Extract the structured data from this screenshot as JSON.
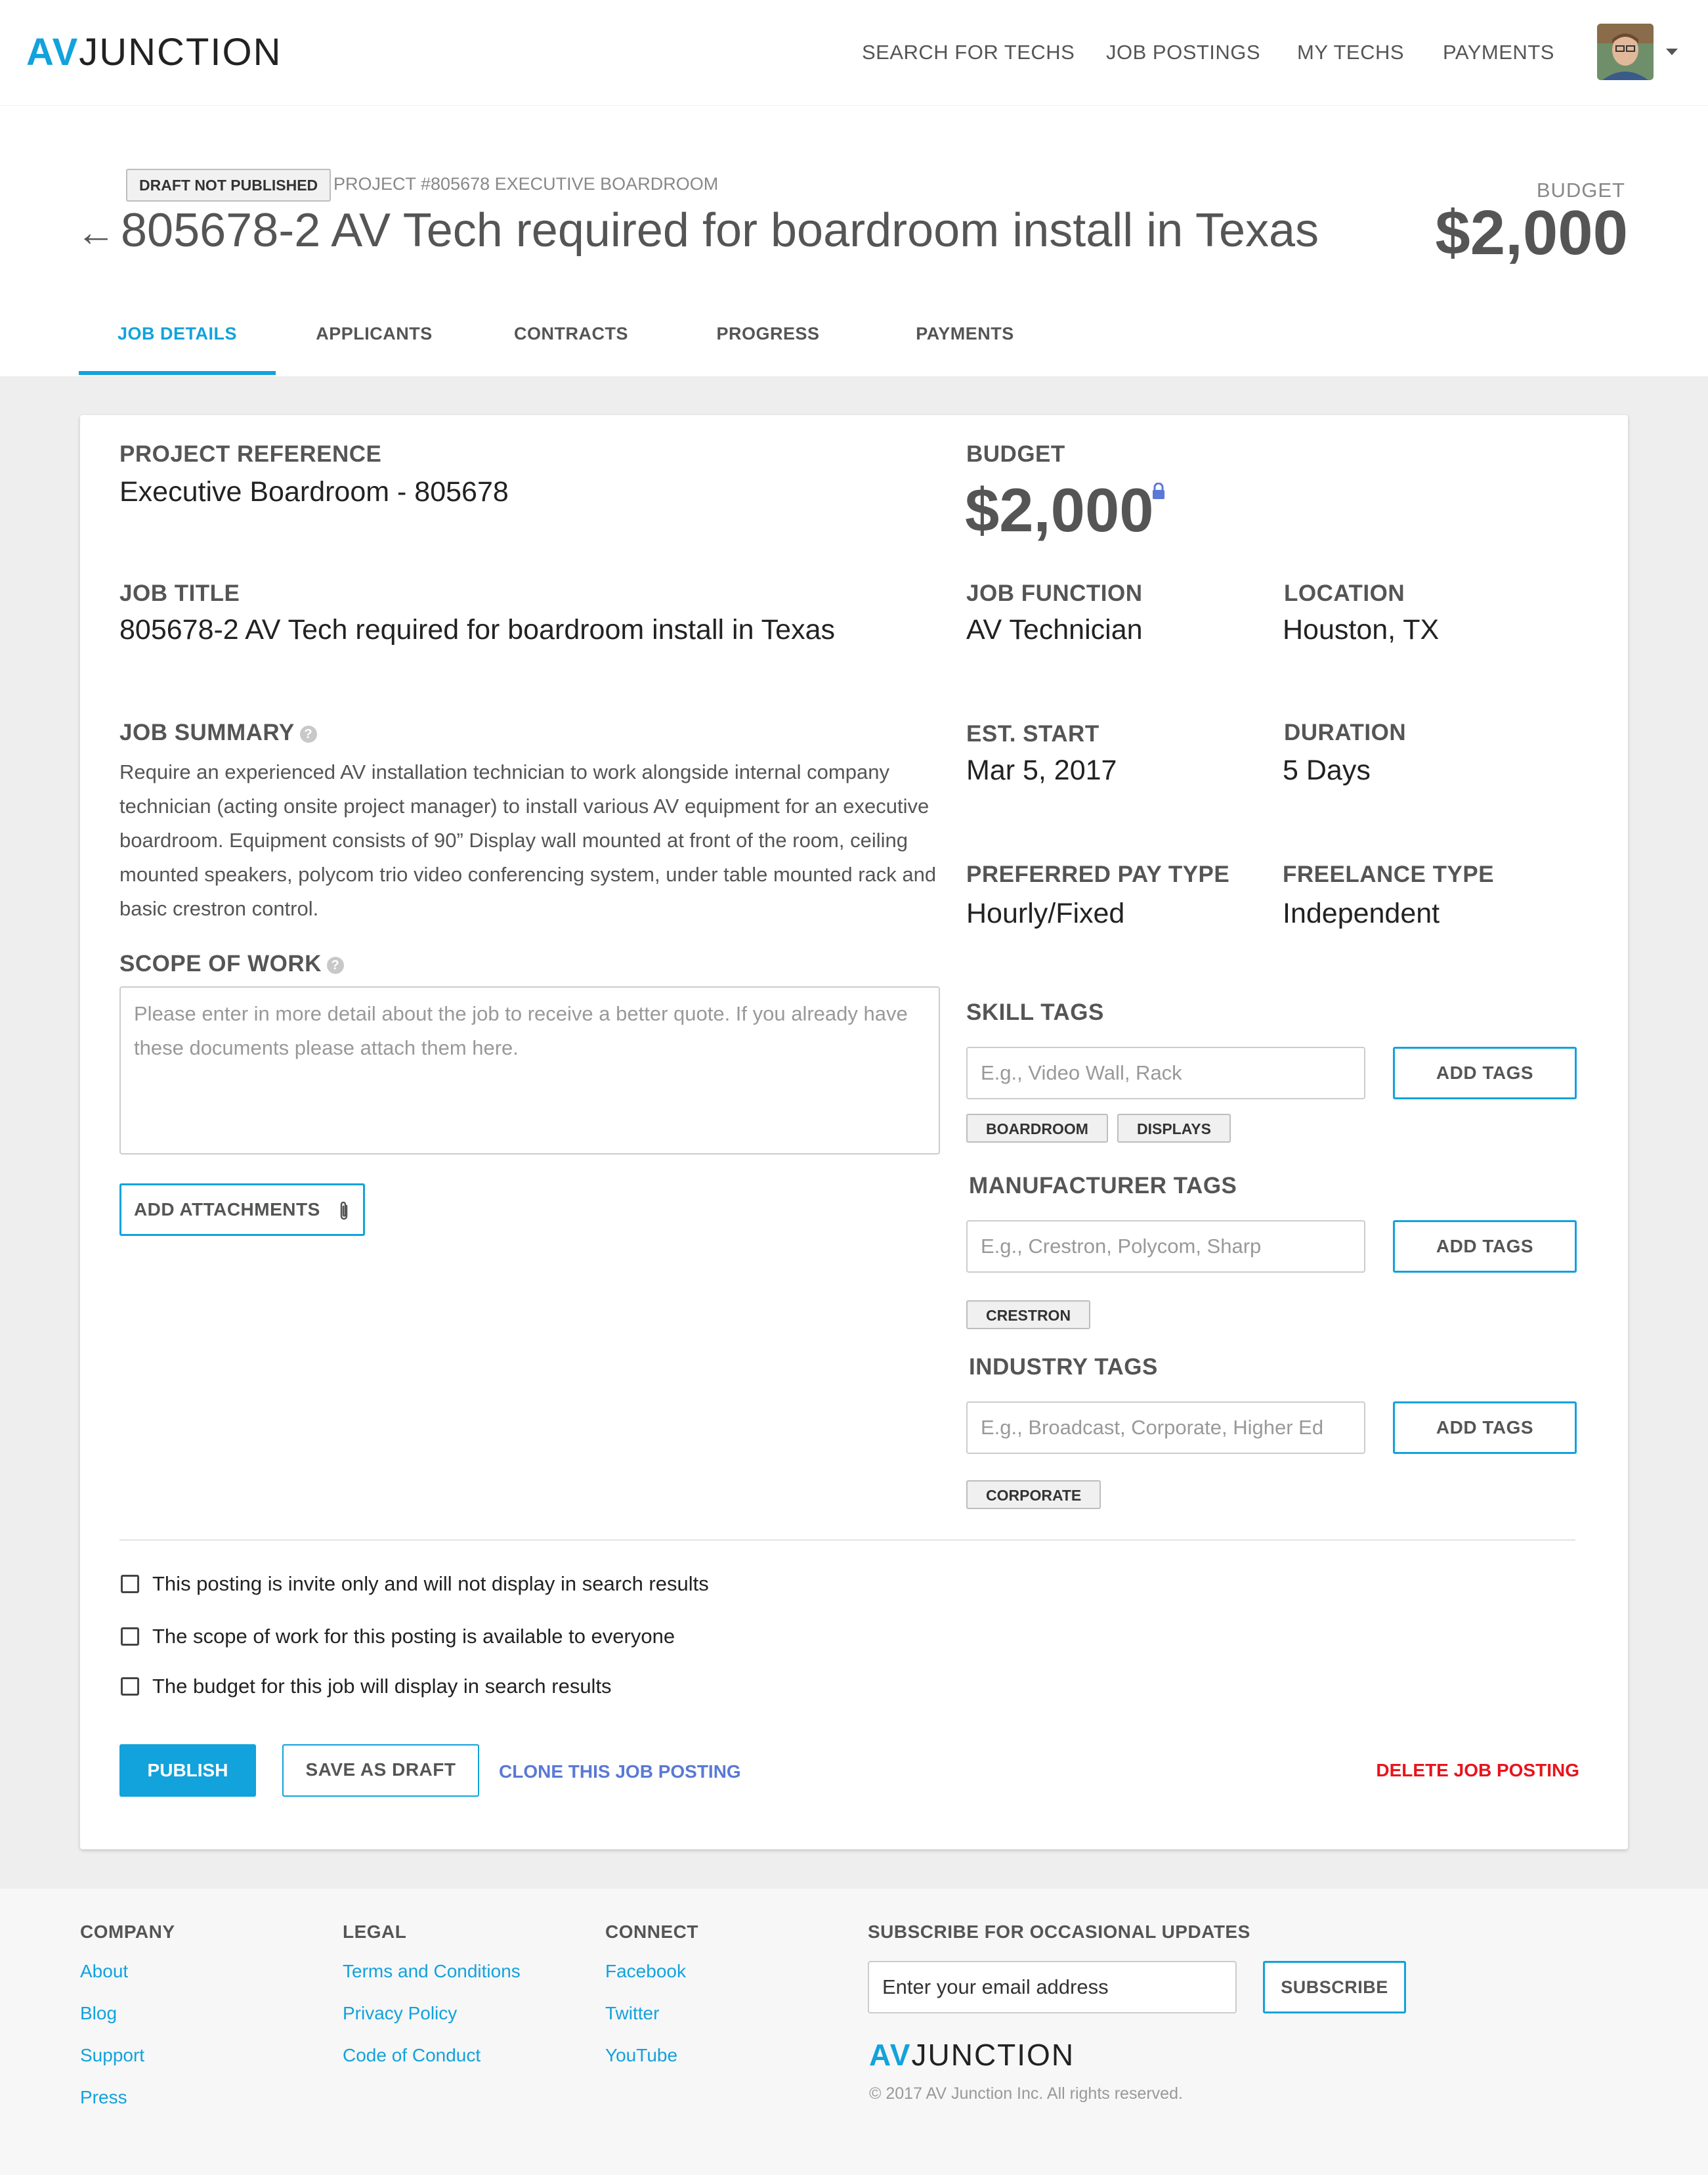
{
  "brand": {
    "logo_av": "AV",
    "logo_rest": "JUNCTION",
    "accent": "#12a2dc",
    "danger": "#e8141c",
    "link_alt": "#5a79d6"
  },
  "nav": {
    "items": [
      "SEARCH FOR TECHS",
      "JOB POSTINGS",
      "MY TECHS",
      "PAYMENTS"
    ],
    "avatar_icon": "user-avatar",
    "menu_icon": "caret-down-icon"
  },
  "header": {
    "status_badge": "DRAFT NOT PUBLISHED",
    "project_subtitle": "PROJECT #805678 EXECUTIVE BOARDROOM",
    "back_icon": "←",
    "title": "805678-2 AV Tech required for boardroom install in Texas",
    "budget_label": "BUDGET",
    "budget_value": "$2,000"
  },
  "tabs": [
    {
      "label": "JOB DETAILS",
      "active": true
    },
    {
      "label": "APPLICANTS",
      "active": false
    },
    {
      "label": "CONTRACTS",
      "active": false
    },
    {
      "label": "PROGRESS",
      "active": false
    },
    {
      "label": "PAYMENTS",
      "active": false
    }
  ],
  "details": {
    "project_reference_label": "PROJECT REFERENCE",
    "project_reference": "Executive Boardroom - 805678",
    "budget_label": "BUDGET",
    "budget_value": "$2,000",
    "job_title_label": "JOB TITLE",
    "job_title": "805678-2 AV Tech required for boardroom install in Texas",
    "job_function_label": "JOB FUNCTION",
    "job_function": "AV Technician",
    "location_label": "LOCATION",
    "location": "Houston, TX",
    "job_summary_label": "JOB SUMMARY",
    "job_summary": "Require an experienced AV installation technician to work alongside internal company technician (acting onsite project manager) to install various AV equipment for an executive boardroom.  Equipment consists of 90” Display wall mounted at front of the room, ceiling mounted speakers, polycom trio video conferencing system, under table mounted rack and basic crestron control.",
    "est_start_label": "EST. START",
    "est_start": "Mar 5, 2017",
    "duration_label": "DURATION",
    "duration": "5 Days",
    "pay_type_label": "PREFERRED PAY TYPE",
    "pay_type": "Hourly/Fixed",
    "freelance_type_label": "FREELANCE TYPE",
    "freelance_type": "Independent",
    "scope_label": "SCOPE OF WORK",
    "scope_placeholder": "Please enter in more detail about the job to receive a better quote. If you already have these documents please attach them here.",
    "add_attachments": "ADD ATTACHMENTS"
  },
  "tags": {
    "add_label": "ADD TAGS",
    "skill": {
      "label": "SKILL TAGS",
      "placeholder": "E.g., Video Wall, Rack",
      "chips": [
        "BOARDROOM",
        "DISPLAYS"
      ]
    },
    "manufacturer": {
      "label": "MANUFACTURER TAGS",
      "placeholder": "E.g., Crestron, Polycom, Sharp",
      "chips": [
        "CRESTRON"
      ]
    },
    "industry": {
      "label": "INDUSTRY TAGS",
      "placeholder": "E.g., Broadcast, Corporate, Higher Ed",
      "chips": [
        "CORPORATE"
      ]
    }
  },
  "options": [
    {
      "label": "This posting is invite only and will not display in search results",
      "checked": false
    },
    {
      "label": "The scope of work for this posting is available to everyone",
      "checked": false
    },
    {
      "label": "The budget for this job will display in search results",
      "checked": false
    }
  ],
  "actions": {
    "publish": "PUBLISH",
    "save_draft": "SAVE AS DRAFT",
    "clone": "CLONE THIS JOB POSTING",
    "delete": "DELETE JOB POSTING"
  },
  "footer": {
    "company": {
      "heading": "COMPANY",
      "links": [
        "About",
        "Blog",
        "Support",
        "Press"
      ]
    },
    "legal": {
      "heading": "LEGAL",
      "links": [
        "Terms and Conditions",
        "Privacy Policy",
        "Code of Conduct"
      ]
    },
    "connect": {
      "heading": "CONNECT",
      "links": [
        "Facebook",
        "Twitter",
        "YouTube"
      ]
    },
    "subscribe": {
      "heading": "SUBSCRIBE FOR OCCASIONAL UPDATES",
      "input_value": "Enter your email address",
      "button": "SUBSCRIBE"
    },
    "logo_av": "AV",
    "logo_rest": "JUNCTION",
    "copyright": "© 2017 AV Junction Inc. All rights reserved."
  }
}
